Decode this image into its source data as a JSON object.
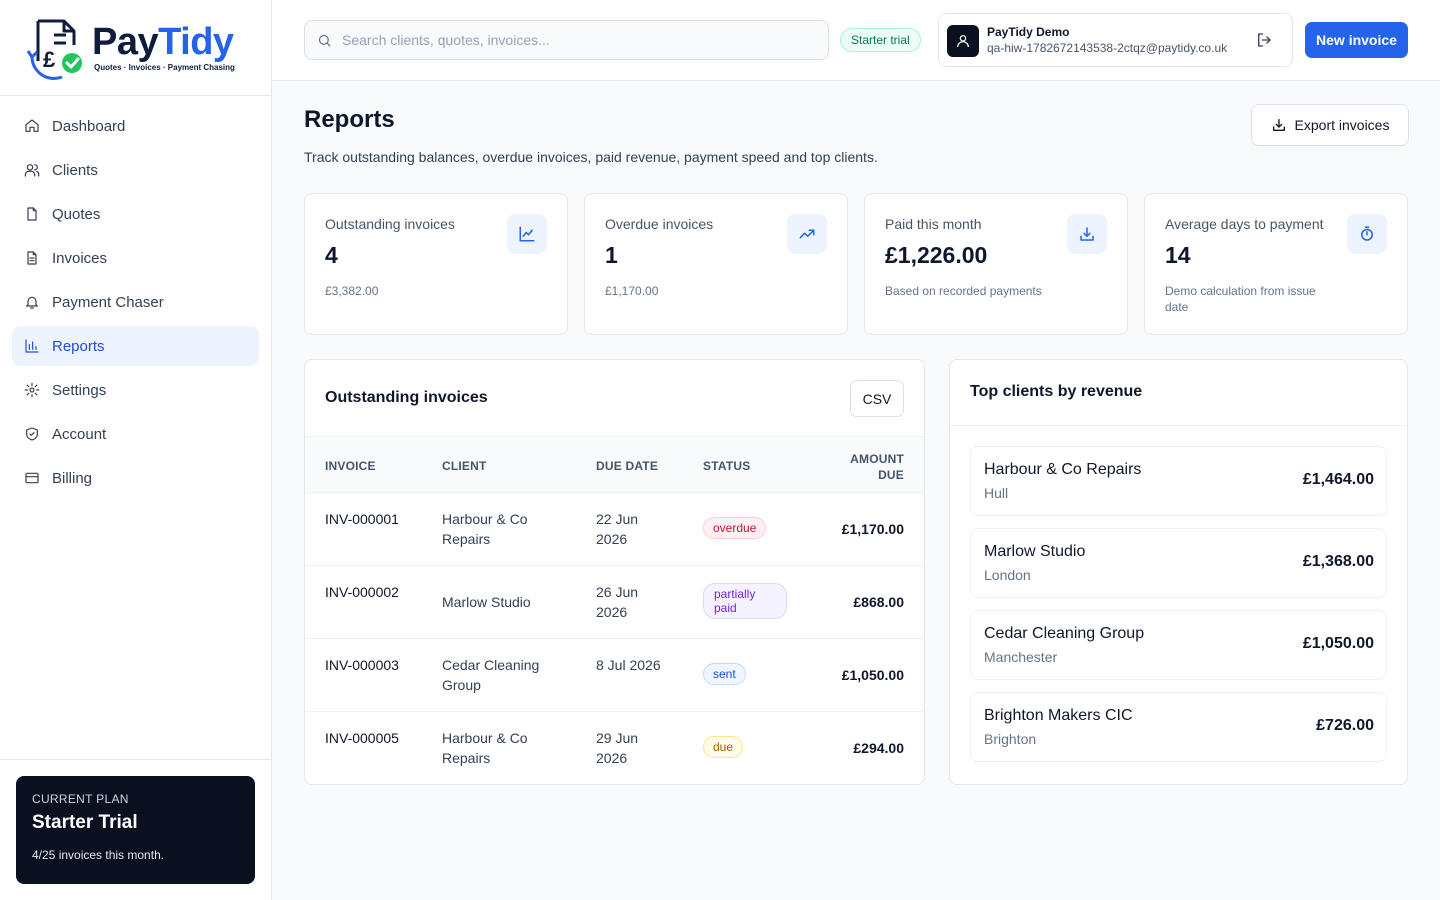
{
  "brand": {
    "name_part1": "Pay",
    "name_part2": "Tidy",
    "tagline": "Quotes · Invoices · Payment Chasing"
  },
  "sidebar": {
    "items": [
      {
        "label": "Dashboard",
        "icon": "home-icon"
      },
      {
        "label": "Clients",
        "icon": "users-icon"
      },
      {
        "label": "Quotes",
        "icon": "file-icon"
      },
      {
        "label": "Invoices",
        "icon": "file-text-icon"
      },
      {
        "label": "Payment Chaser",
        "icon": "bell-icon"
      },
      {
        "label": "Reports",
        "icon": "bar-chart-icon",
        "active": true
      },
      {
        "label": "Settings",
        "icon": "gear-icon"
      },
      {
        "label": "Account",
        "icon": "shield-icon"
      },
      {
        "label": "Billing",
        "icon": "credit-card-icon"
      }
    ],
    "plan": {
      "label": "CURRENT PLAN",
      "name": "Starter Trial",
      "usage": "4/25 invoices this month."
    }
  },
  "topbar": {
    "search_placeholder": "Search clients, quotes, invoices...",
    "trial_badge": "Starter trial",
    "user_name": "PayTidy Demo",
    "user_email": "qa-hiw-1782672143538-2ctqz@paytidy.co.uk",
    "new_invoice_label": "New invoice"
  },
  "page": {
    "title": "Reports",
    "subtitle": "Track outstanding balances, overdue invoices, paid revenue, payment speed and top clients.",
    "export_label": "Export invoices"
  },
  "stats": [
    {
      "label": "Outstanding invoices",
      "value": "4",
      "sub": "£3,382.00",
      "icon": "line-chart-icon"
    },
    {
      "label": "Overdue invoices",
      "value": "1",
      "sub": "£1,170.00",
      "icon": "trending-up-icon"
    },
    {
      "label": "Paid this month",
      "value": "£1,226.00",
      "sub": "Based on recorded payments",
      "icon": "download-icon"
    },
    {
      "label": "Average days to payment",
      "value": "14",
      "sub": "Demo calculation from issue date",
      "icon": "stopwatch-icon"
    }
  ],
  "outstanding": {
    "title": "Outstanding invoices",
    "csv_label": "CSV",
    "columns": {
      "invoice": "INVOICE",
      "client": "CLIENT",
      "due_date": "DUE DATE",
      "status": "STATUS",
      "amount_due": "AMOUNT DUE"
    },
    "rows": [
      {
        "invoice": "INV-000001",
        "client": "Harbour & Co Repairs",
        "due_date": "22 Jun 2026",
        "status": "overdue",
        "amount": "£1,170.00"
      },
      {
        "invoice": "INV-000002",
        "client": "Marlow Studio",
        "due_date": "26 Jun 2026",
        "status": "partially paid",
        "amount": "£868.00"
      },
      {
        "invoice": "INV-000003",
        "client": "Cedar Cleaning Group",
        "due_date": "8 Jul 2026",
        "status": "sent",
        "amount": "£1,050.00"
      },
      {
        "invoice": "INV-000005",
        "client": "Harbour & Co Repairs",
        "due_date": "29 Jun 2026",
        "status": "due",
        "amount": "£294.00"
      }
    ]
  },
  "top_clients": {
    "title": "Top clients by revenue",
    "items": [
      {
        "name": "Harbour & Co Repairs",
        "city": "Hull",
        "revenue": "£1,464.00"
      },
      {
        "name": "Marlow Studio",
        "city": "London",
        "revenue": "£1,368.00"
      },
      {
        "name": "Cedar Cleaning Group",
        "city": "Manchester",
        "revenue": "£1,050.00"
      },
      {
        "name": "Brighton Makers CIC",
        "city": "Brighton",
        "revenue": "£726.00"
      }
    ]
  },
  "colors": {
    "accent": "#2563eb",
    "brand_dark": "#0f1d3a",
    "plan_card_bg": "#0b1020",
    "overdue": "#be123c",
    "partial": "#6d28d9",
    "sent": "#1d4ed8",
    "due": "#a16207",
    "trial_green": "#047857"
  }
}
